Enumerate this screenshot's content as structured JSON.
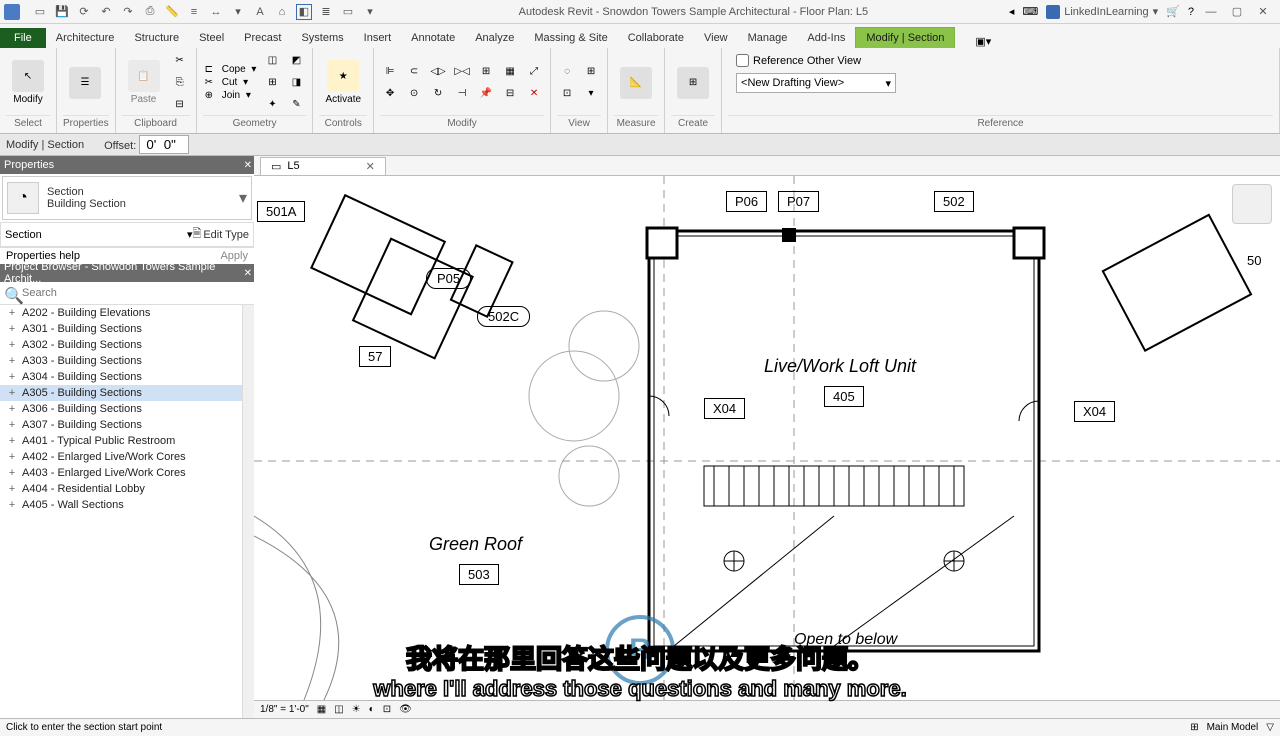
{
  "app": {
    "title": "Autodesk Revit - Snowdon Towers Sample Architectural - Floor Plan: L5",
    "user": "LinkedInLearning"
  },
  "ribbonTabs": {
    "file": "File",
    "items": [
      "Architecture",
      "Structure",
      "Steel",
      "Precast",
      "Systems",
      "Insert",
      "Annotate",
      "Analyze",
      "Massing & Site",
      "Collaborate",
      "View",
      "Manage",
      "Add-Ins"
    ],
    "active": "Modify | Section"
  },
  "ribbonPanels": {
    "select": {
      "title": "Select",
      "modify": "Modify",
      "properties": "Properties"
    },
    "clipboard": {
      "title": "Clipboard",
      "paste": "Paste"
    },
    "geometry": {
      "title": "Geometry",
      "cope": "Cope",
      "cut": "Cut",
      "join": "Join"
    },
    "controls": {
      "title": "Controls",
      "activate": "Activate"
    },
    "modify": {
      "title": "Modify"
    },
    "view": {
      "title": "View"
    },
    "measure": {
      "title": "Measure"
    },
    "create": {
      "title": "Create"
    },
    "reference": {
      "title": "Reference",
      "checkbox": "Reference Other View",
      "dropdown": "<New Drafting View>"
    }
  },
  "optionsBar": {
    "context": "Modify | Section",
    "offsetLabel": "Offset:",
    "offsetValue": "0'  0\""
  },
  "propertiesPanel": {
    "title": "Properties",
    "typeName": "Section",
    "typeFamily": "Building Section",
    "instanceLabel": "Section",
    "editType": "Edit Type",
    "help": "Properties help",
    "apply": "Apply"
  },
  "projectBrowser": {
    "title": "Project Browser - Snowdon Towers Sample Archit...",
    "searchPlaceholder": "Search",
    "items": [
      "A202 - Building Elevations",
      "A301 - Building Sections",
      "A302 - Building Sections",
      "A303 - Building Sections",
      "A304 - Building Sections",
      "A305 - Building Sections",
      "A306 - Building Sections",
      "A307 - Building Sections",
      "A401 - Typical Public Restroom",
      "A402 - Enlarged Live/Work Cores",
      "A403 - Enlarged Live/Work Cores",
      "A404 - Residential Lobby",
      "A405 - Wall Sections"
    ],
    "selectedIndex": 5
  },
  "viewTab": {
    "name": "L5"
  },
  "floorPlan": {
    "gridP06": "P06",
    "gridP07": "P07",
    "room502": "502",
    "room501A": "501A",
    "door502C": "502C",
    "doorP05": "P05",
    "door57": "57",
    "loftLabel": "Live/Work Loft Unit",
    "loft405": "405",
    "x04a": "X04",
    "x04b": "X04",
    "roof50": "50",
    "greenRoof": "Green Roof",
    "roof503": "503",
    "openBelow": "Open to below"
  },
  "viewControl": {
    "scale": "1/8\" = 1'-0\""
  },
  "statusBar": {
    "hint": "Click to enter the section start point",
    "model": "Main Model"
  },
  "subtitle": {
    "cn": "我将在那里回答这些问题以及更多问题。",
    "en": "where I'll address those questions and many more."
  },
  "brand": "Linked in Learning"
}
